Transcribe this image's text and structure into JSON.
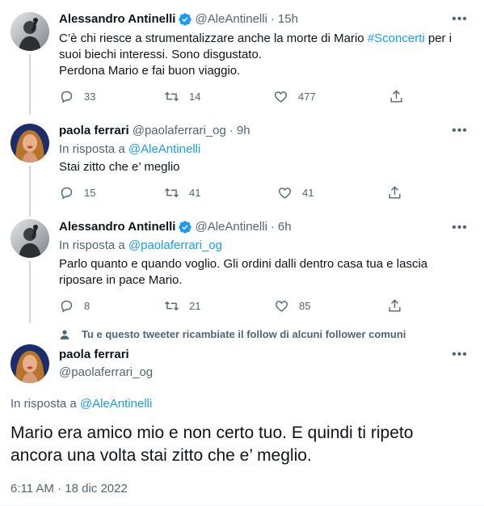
{
  "colors": {
    "accent": "#1d9bf0",
    "muted": "#536471",
    "text": "#0f1419",
    "line": "#cfd9de"
  },
  "tweets": [
    {
      "name": "Alessandro Antinelli",
      "verified": true,
      "handle": "@AleAntinelli",
      "separator": "·",
      "time": "15h",
      "text_before": "C’è chi riesce a strumentalizzare anche la morte di Mario ",
      "hashtag": "#Sconcerti",
      "text_after": " per i suoi biechi interessi. Sono disgustato.",
      "text_line2": "Perdona Mario e fai buon viaggio.",
      "replies": "33",
      "retweets": "14",
      "likes": "477",
      "avatar_icon": "man-with-microphone-avatar"
    },
    {
      "name": "paola ferrari",
      "handle": "@paolaferrari_og",
      "separator": "·",
      "time": "9h",
      "reply_prefix": "In risposta a",
      "reply_to": "@AleAntinelli",
      "text": "Stai zitto che e’ meglio",
      "replies": "15",
      "retweets": "41",
      "likes": "41",
      "avatar_icon": "woman-portrait-avatar"
    },
    {
      "name": "Alessandro Antinelli",
      "verified": true,
      "handle": "@AleAntinelli",
      "separator": "·",
      "time": "6h",
      "reply_prefix": "In risposta a",
      "reply_to": "@paolaferrari_og",
      "text_line1": "Parlo quanto e quando voglio. Gli ordini dalli dentro casa tua e lascia",
      "text_line2": "riposare in pace Mario.",
      "replies": "8",
      "retweets": "21",
      "likes": "85",
      "avatar_icon": "man-with-microphone-avatar"
    }
  ],
  "social_context": "Tu e questo tweeter ricambiate il follow di alcuni follower comuni",
  "main_tweet": {
    "name": "paola ferrari",
    "handle": "@paolaferrari_og",
    "reply_prefix": "In risposta a",
    "reply_to": "@AleAntinelli",
    "text_line1": "Mario era amico mio e non certo tuo. E quindi ti ripeto",
    "text_line2": "ancora una volta stai zitto che e’ meglio.",
    "timestamp": "6:11 AM · 18 dic 2022",
    "avatar_icon": "woman-portrait-avatar"
  }
}
